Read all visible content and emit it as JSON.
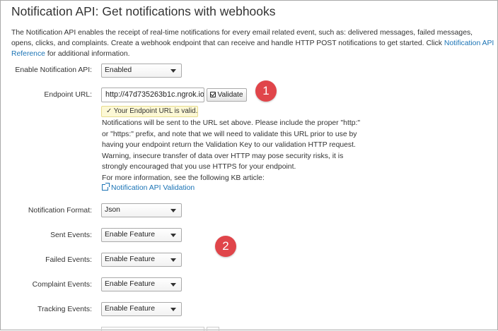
{
  "page": {
    "title": "Notification API: Get notifications with webhooks",
    "intro_text": "The Notification API enables the receipt of real-time notifications for every email related event, such as: delivered messages, failed messages, opens, clicks, and complaints. Create a webhook endpoint that can receive and handle HTTP POST notifications to get started. Click ",
    "intro_link": "Notification API Reference",
    "intro_suffix": " for additional information."
  },
  "form": {
    "enable_label": "Enable Notification API:",
    "enable_value": "Enabled",
    "endpoint_label": "Endpoint URL:",
    "endpoint_value": "http://47d735263b1c.ngrok.io",
    "validate_label": "Validate",
    "valid_message": "✓ Your Endpoint URL is valid.",
    "help_text": "Notifications will be sent to the URL set above. Please include the proper \"http:\" or \"https:\" prefix, and note that we will need to validate this URL prior to use by having your endpoint return the Validation Key to our validation HTTP request. Warning, insecure transfer of data over HTTP may pose security risks, it is strongly encouraged that you use HTTPS for your endpoint.",
    "kb_text": "For more information, see the following KB article:",
    "kb_link": "Notification API Validation",
    "format_label": "Notification Format:",
    "format_value": "Json",
    "sent_label": "Sent Events:",
    "sent_value": "Enable Feature",
    "failed_label": "Failed Events:",
    "failed_value": "Enable Feature",
    "complaint_label": "Complaint Events:",
    "complaint_value": "Enable Feature",
    "tracking_label": "Tracking Events:",
    "tracking_value": "Enable Feature"
  },
  "markers": {
    "one": "1",
    "two": "2"
  },
  "colors": {
    "link": "#1a73b5",
    "marker": "#e0454a",
    "valid_bg": "#fcf8d5"
  }
}
